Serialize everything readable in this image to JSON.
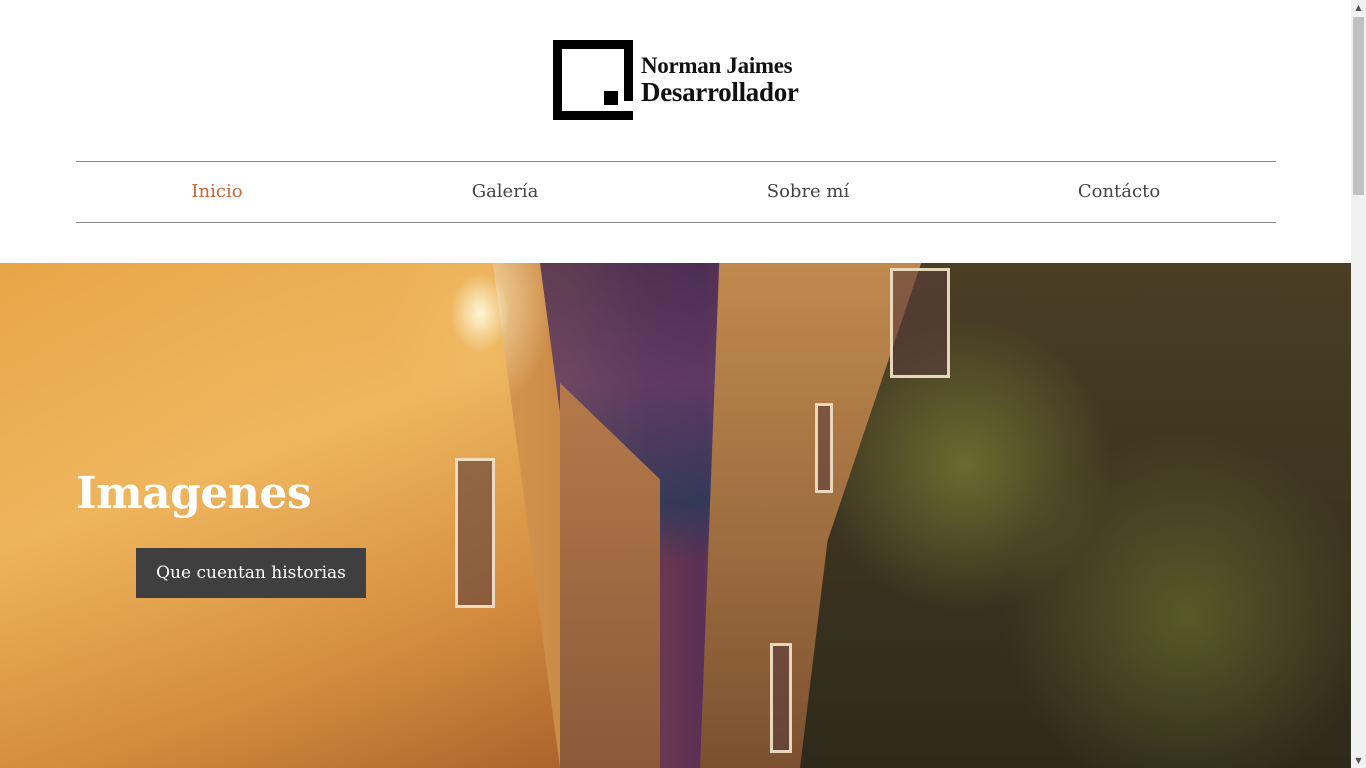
{
  "header": {
    "logo_name": "Norman Jaimes",
    "logo_role": "Desarrollador"
  },
  "nav": {
    "items": [
      {
        "label": "Inicio",
        "active": true
      },
      {
        "label": "Galería",
        "active": false
      },
      {
        "label": "Sobre mí",
        "active": false
      },
      {
        "label": "Contácto",
        "active": false
      }
    ]
  },
  "hero": {
    "title": "Imagenes",
    "button_label": "Que cuentan historias"
  },
  "colors": {
    "accent": "#c8663a",
    "nav_text": "#444444",
    "button_bg": "#3f3f3f"
  },
  "icons": {
    "scroll_up": "▲",
    "scroll_down": "▼"
  }
}
